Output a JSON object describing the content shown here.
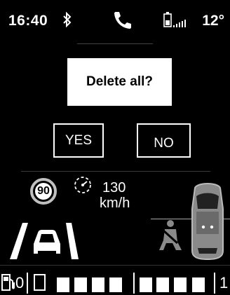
{
  "status_bar": {
    "time": "16:40",
    "temperature": "12°",
    "icons": [
      "bluetooth-icon",
      "phone-call-icon",
      "battery-icon",
      "signal-icon"
    ]
  },
  "dialog": {
    "prompt": "Delete all?",
    "yes_label": "YES",
    "no_label": "NO"
  },
  "speed": {
    "limit": "90",
    "cruise_speed": "130",
    "unit": "km/h"
  },
  "fuel": {
    "min_label": "0",
    "max_label": "1",
    "segments_total": 9,
    "segments_filled": 8
  },
  "colors": {
    "background": "#000000",
    "foreground": "#ffffff",
    "dim": "#8a8a8a"
  }
}
